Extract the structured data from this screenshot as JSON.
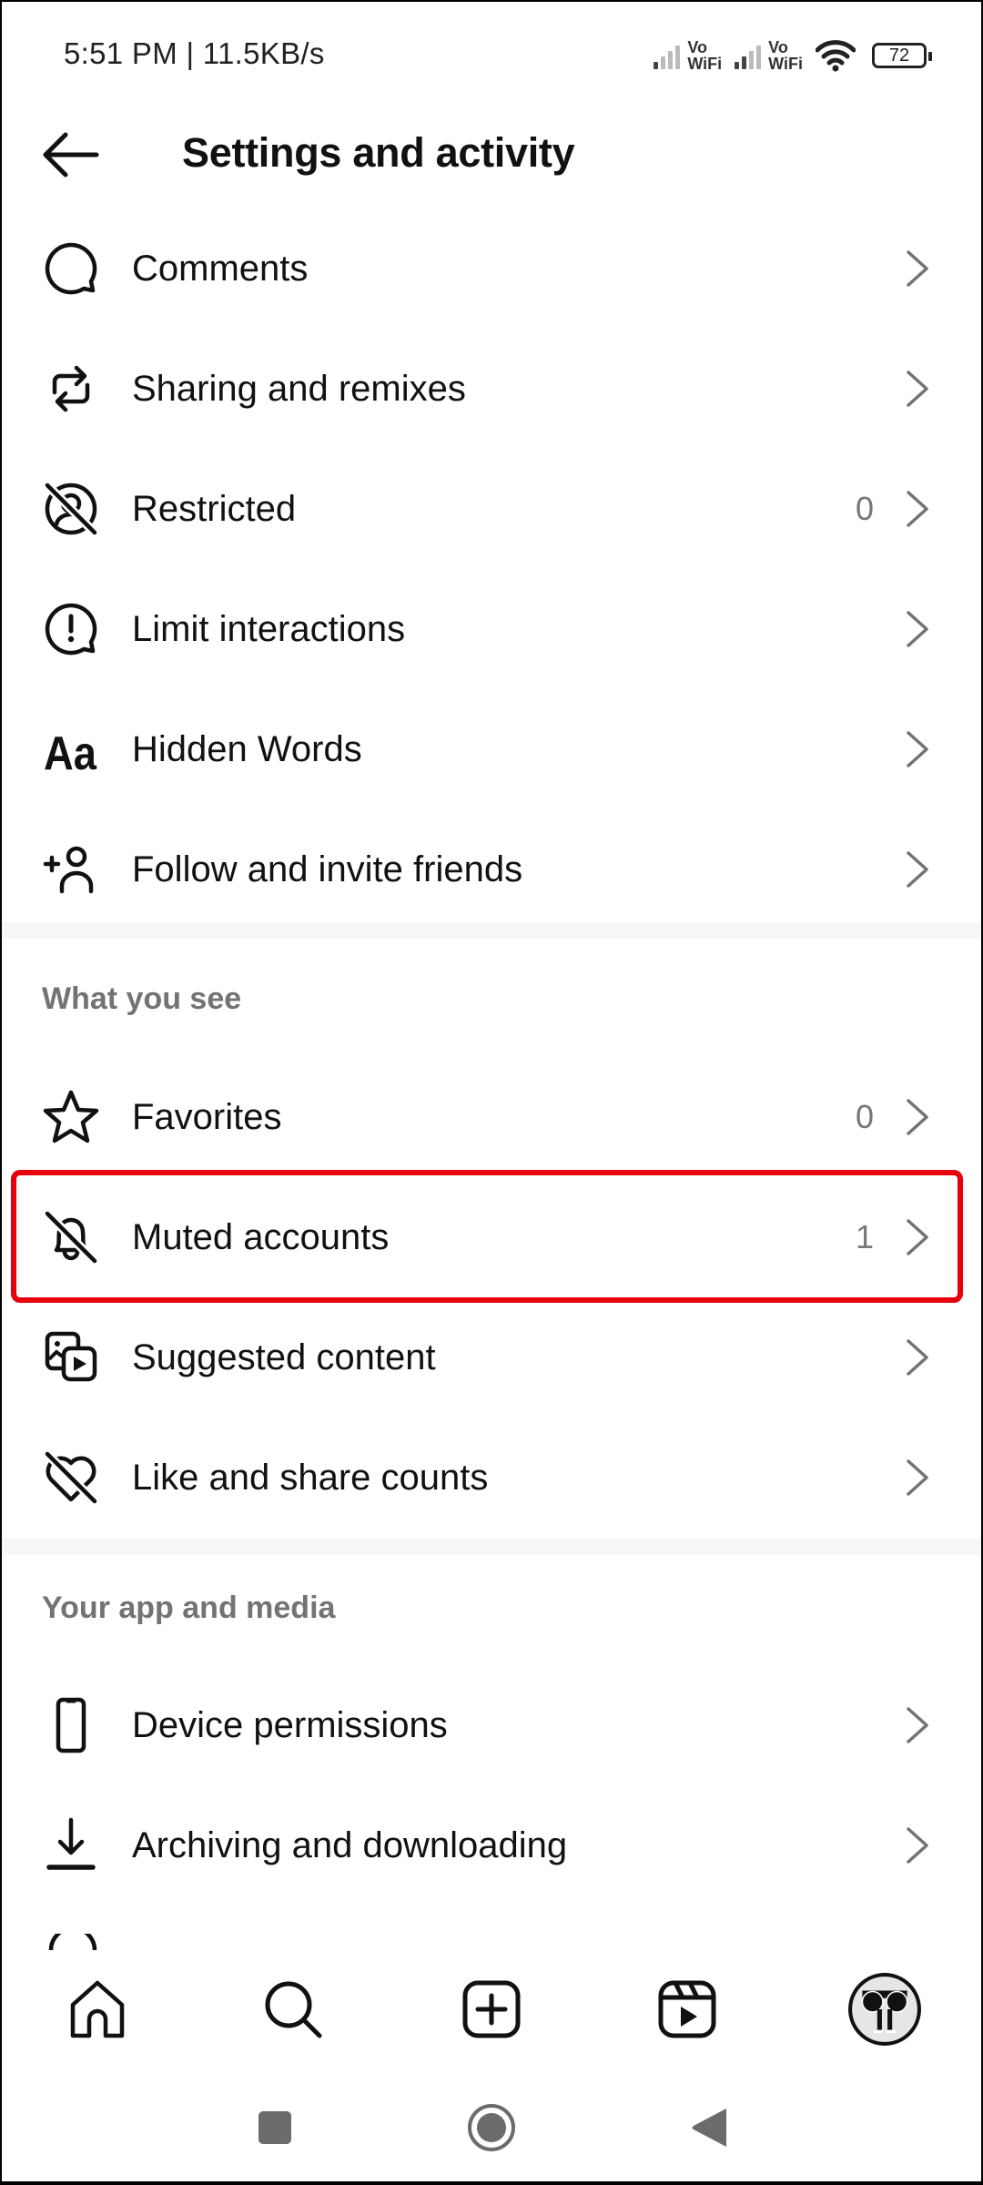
{
  "status_bar": {
    "time_speed": "5:51 PM | 11.5KB/s",
    "sim1_label_top": "Vo",
    "sim1_label_bottom": "WiFi",
    "sim2_label_top": "Vo",
    "sim2_label_bottom": "WiFi",
    "battery_level": "72"
  },
  "header": {
    "title": "Settings and activity",
    "back_icon": "arrow-left-icon"
  },
  "sections": [
    {
      "heading": null,
      "items": [
        {
          "label": "Comments",
          "icon": "comment-bubble-icon",
          "count": null
        },
        {
          "label": "Sharing and remixes",
          "icon": "share-remix-icon",
          "count": null
        },
        {
          "label": "Restricted",
          "icon": "restricted-user-icon",
          "count": "0"
        },
        {
          "label": "Limit interactions",
          "icon": "alert-bubble-icon",
          "count": null
        },
        {
          "label": "Hidden Words",
          "icon": "text-aa-icon",
          "count": null
        },
        {
          "label": "Follow and invite friends",
          "icon": "add-person-icon",
          "count": null
        }
      ]
    },
    {
      "heading": "What you see",
      "items": [
        {
          "label": "Favorites",
          "icon": "star-icon",
          "count": "0"
        },
        {
          "label": "Muted accounts",
          "icon": "bell-off-icon",
          "count": "1",
          "highlighted": true
        },
        {
          "label": "Suggested content",
          "icon": "media-stack-icon",
          "count": null
        },
        {
          "label": "Like and share counts",
          "icon": "heart-off-icon",
          "count": null
        }
      ]
    },
    {
      "heading": "Your app and media",
      "items": [
        {
          "label": "Device permissions",
          "icon": "phone-icon",
          "count": null
        },
        {
          "label": "Archiving and downloading",
          "icon": "download-icon",
          "count": null
        }
      ]
    }
  ],
  "highlight_color": "#e8000c",
  "bottom_nav": [
    {
      "name": "home",
      "icon": "home-icon"
    },
    {
      "name": "search",
      "icon": "search-icon"
    },
    {
      "name": "create",
      "icon": "plus-square-icon"
    },
    {
      "name": "reels",
      "icon": "reels-icon"
    },
    {
      "name": "profile",
      "icon": "profile-avatar-icon"
    }
  ],
  "system_nav": [
    {
      "name": "recents",
      "icon": "square-icon"
    },
    {
      "name": "home",
      "icon": "circle-icon"
    },
    {
      "name": "back",
      "icon": "triangle-back-icon"
    }
  ]
}
